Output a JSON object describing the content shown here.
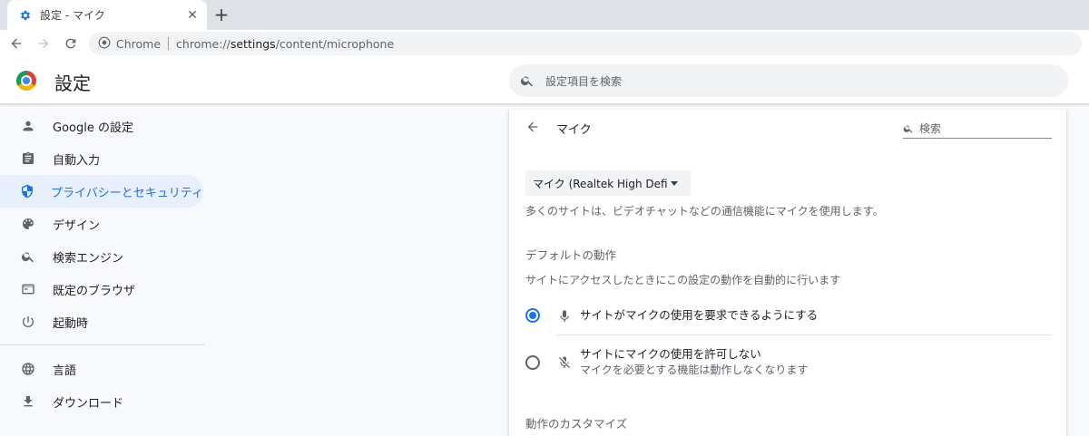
{
  "browser": {
    "tab": {
      "title": "設定 - マイク",
      "close_glyph": "✕"
    },
    "new_tab_glyph": "+",
    "omnibox": {
      "site_chip": "Chrome",
      "url_prefix": "chrome://",
      "url_host": "settings",
      "url_path": "/content/microphone"
    }
  },
  "header": {
    "title": "設定",
    "search_placeholder": "設定項目を検索"
  },
  "sidebar": {
    "items": [
      {
        "label": "Google の設定",
        "icon": "person-icon",
        "active": false
      },
      {
        "label": "自動入力",
        "icon": "clipboard-icon",
        "active": false
      },
      {
        "label": "プライバシーとセキュリティ",
        "icon": "shield-icon",
        "active": true
      },
      {
        "label": "デザイン",
        "icon": "palette-icon",
        "active": false
      },
      {
        "label": "検索エンジン",
        "icon": "search-icon",
        "active": false
      },
      {
        "label": "既定のブラウザ",
        "icon": "browser-icon",
        "active": false
      },
      {
        "label": "起動時",
        "icon": "power-icon",
        "active": false
      }
    ],
    "items_secondary": [
      {
        "label": "言語",
        "icon": "globe-icon"
      },
      {
        "label": "ダウンロード",
        "icon": "download-icon"
      }
    ]
  },
  "main": {
    "subtitle": "マイク",
    "search_placeholder": "検索",
    "device_select": "マイク (Realtek High Definitio",
    "description": "多くのサイトは、ビデオチャットなどの通信機能にマイクを使用します。",
    "default_behavior": {
      "title": "デフォルトの動作",
      "description": "サイトにアクセスしたときにこの設定の動作を自動的に行います",
      "options": [
        {
          "label": "サイトがマイクの使用を要求できるようにする",
          "sublabel": "",
          "checked": true
        },
        {
          "label": "サイトにマイクの使用を許可しない",
          "sublabel": "マイクを必要とする機能は動作しなくなります",
          "checked": false
        }
      ]
    },
    "customize_title": "動作のカスタマイズ"
  },
  "colors": {
    "accent": "#1a73e8",
    "active_bg": "#e8f0fe",
    "icon_gray": "#5f6368"
  }
}
